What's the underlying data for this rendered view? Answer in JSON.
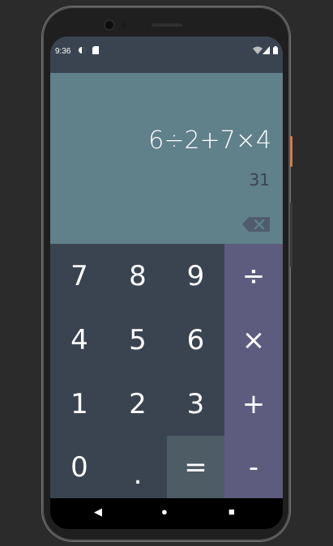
{
  "status_bar": {
    "time": "9:36",
    "icons": [
      "notification-icon",
      "sd-card-icon",
      "wifi-icon",
      "signal-icon",
      "battery-icon"
    ]
  },
  "display": {
    "expression": "6÷2+7×4",
    "result": "31",
    "backspace_icon": "backspace-icon"
  },
  "keys": {
    "numbers": [
      [
        "7",
        "8",
        "9"
      ],
      [
        "4",
        "5",
        "6"
      ],
      [
        "1",
        "2",
        "3"
      ],
      [
        "0",
        ".",
        "="
      ]
    ],
    "operators": [
      "÷",
      "×",
      "+",
      "-"
    ]
  },
  "nav_bar": {
    "back": "◀",
    "home": "●",
    "recents": "■"
  },
  "colors": {
    "display_bg": "#60808a",
    "numpad_bg": "#3a4451",
    "ops_bg": "#5d5c7e",
    "equals_bg": "#4e5c66",
    "result_text": "#3a4451",
    "accent_side": "#d97a4a"
  }
}
